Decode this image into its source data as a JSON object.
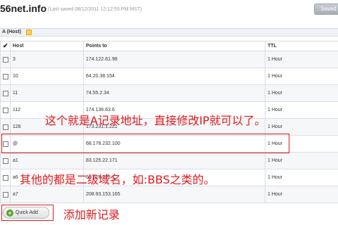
{
  "header": {
    "domain": "56net.info",
    "saved": "(Last saved 08/12/2011 12:12:55 PM MST)",
    "save_label": "Saved"
  },
  "section": {
    "title": "A (Host)"
  },
  "table": {
    "columns": [
      "Host",
      "Points to",
      "TTL"
    ],
    "rows": [
      {
        "host": "3",
        "points_to": "174.122.61.98",
        "ttl": "1 Hour"
      },
      {
        "host": "10",
        "points_to": "64.20.38.154",
        "ttl": "1 Hour"
      },
      {
        "host": "11",
        "points_to": "74.55.2.34",
        "ttl": "1 Hour"
      },
      {
        "host": "112",
        "points_to": "174.136.63.6",
        "ttl": "1 Hour"
      },
      {
        "host": "128",
        "points_to": "173.231.1.221",
        "ttl": "1 Hour"
      },
      {
        "host": "@",
        "points_to": "68.178.232.100",
        "ttl": "1 Hour"
      },
      {
        "host": "a1",
        "points_to": "83.125.22.171",
        "ttl": "1 Hour"
      },
      {
        "host": "a6",
        "points_to": "69.125.225.1",
        "ttl": "1 Hour"
      },
      {
        "host": "a7",
        "points_to": "208.93.153.165",
        "ttl": "1 Hour"
      }
    ]
  },
  "quick_add": {
    "label": "Quick Add"
  },
  "annotations": {
    "a": "这个就是A记录地址，直接修改IP就可以了。",
    "b": "其他的都是二级域名，如:BBS之类的。",
    "c": "添加新记录"
  },
  "colors": {
    "annotation": "#e0191c"
  }
}
